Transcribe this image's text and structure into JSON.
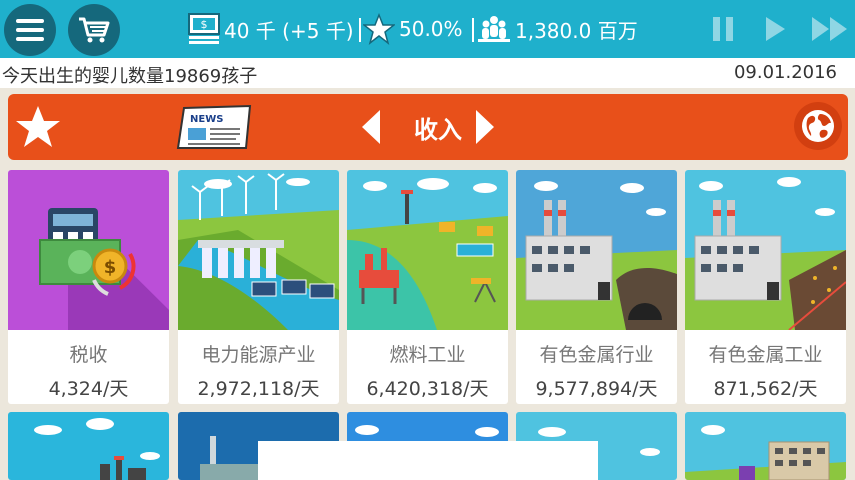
{
  "top_bar": {
    "money": "40 千 (+5 千)",
    "approval": "50.0%",
    "population": "1,380.0 百万"
  },
  "news": {
    "text": "今天出生的婴儿数量19869孩子",
    "date": "09.01.2016"
  },
  "category": {
    "title": "收入",
    "newspaper_label": "NEWS"
  },
  "industries": [
    {
      "name": "税收",
      "rate": "4,324/天"
    },
    {
      "name": "电力能源产业",
      "rate": "2,972,118/天"
    },
    {
      "name": "燃料工业",
      "rate": "6,420,318/天"
    },
    {
      "name": "有色金属行业",
      "rate": "9,577,894/天"
    },
    {
      "name": "有色金属工业",
      "rate": "871,562/天"
    }
  ],
  "colors": {
    "topbar": "#1fb0cc",
    "header": "#e8501a",
    "background": "#ece7dc"
  }
}
